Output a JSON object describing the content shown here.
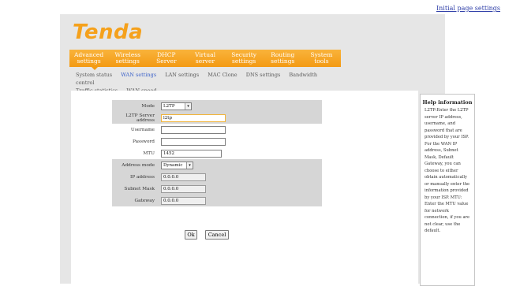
{
  "top_link": "Initial page settings",
  "logo": "Tenda",
  "nav": {
    "items": [
      {
        "line1": "Advanced",
        "line2": "settings"
      },
      {
        "line1": "Wireless",
        "line2": "settings"
      },
      {
        "line1": "DHCP",
        "line2": "Server"
      },
      {
        "line1": "Virtual",
        "line2": "server"
      },
      {
        "line1": "Security",
        "line2": "settings"
      },
      {
        "line1": "Routing",
        "line2": "settings"
      },
      {
        "line1": "System",
        "line2": "tools"
      }
    ],
    "active_index": 0
  },
  "subnav": {
    "items": [
      "System status",
      "WAN settings",
      "LAN settings",
      "MAC Clone",
      "DNS settings",
      "Bandwidth control",
      "Traffic statistics",
      "WAN speed"
    ],
    "active": "WAN settings"
  },
  "form": {
    "mode_label": "Mode",
    "mode_value": "L2TP",
    "server_label": "L2TP Server address",
    "server_value": "l2tp",
    "username_label": "Username",
    "username_value": "",
    "password_label": "Password",
    "password_value": "",
    "mtu_label": "MTU",
    "mtu_value": "1452",
    "address_mode_label": "Address mode",
    "address_mode_value": "Dynamic",
    "ip_label": "IP address",
    "ip_value": "0.0.0.0",
    "mask_label": "Subnet Mask",
    "mask_value": "0.0.0.0",
    "gateway_label": "Gateway",
    "gateway_value": "0.0.0.0"
  },
  "buttons": {
    "ok": "Ok",
    "cancel": "Cancel"
  },
  "help": {
    "title": "Help information",
    "text": "L2TP:Enter the L2TP server IP address, username, and password that are provided by your ISP. For the WAN IP address, Subnet Mask, Default Gateway, you can choose to either obtain automatically or manually enter the information provided by your ISP. MTU: Enter the MTU value for network connection, if you are not clear, use the default."
  },
  "colors": {
    "accent": "#f39a14",
    "link": "#3d63c9"
  }
}
